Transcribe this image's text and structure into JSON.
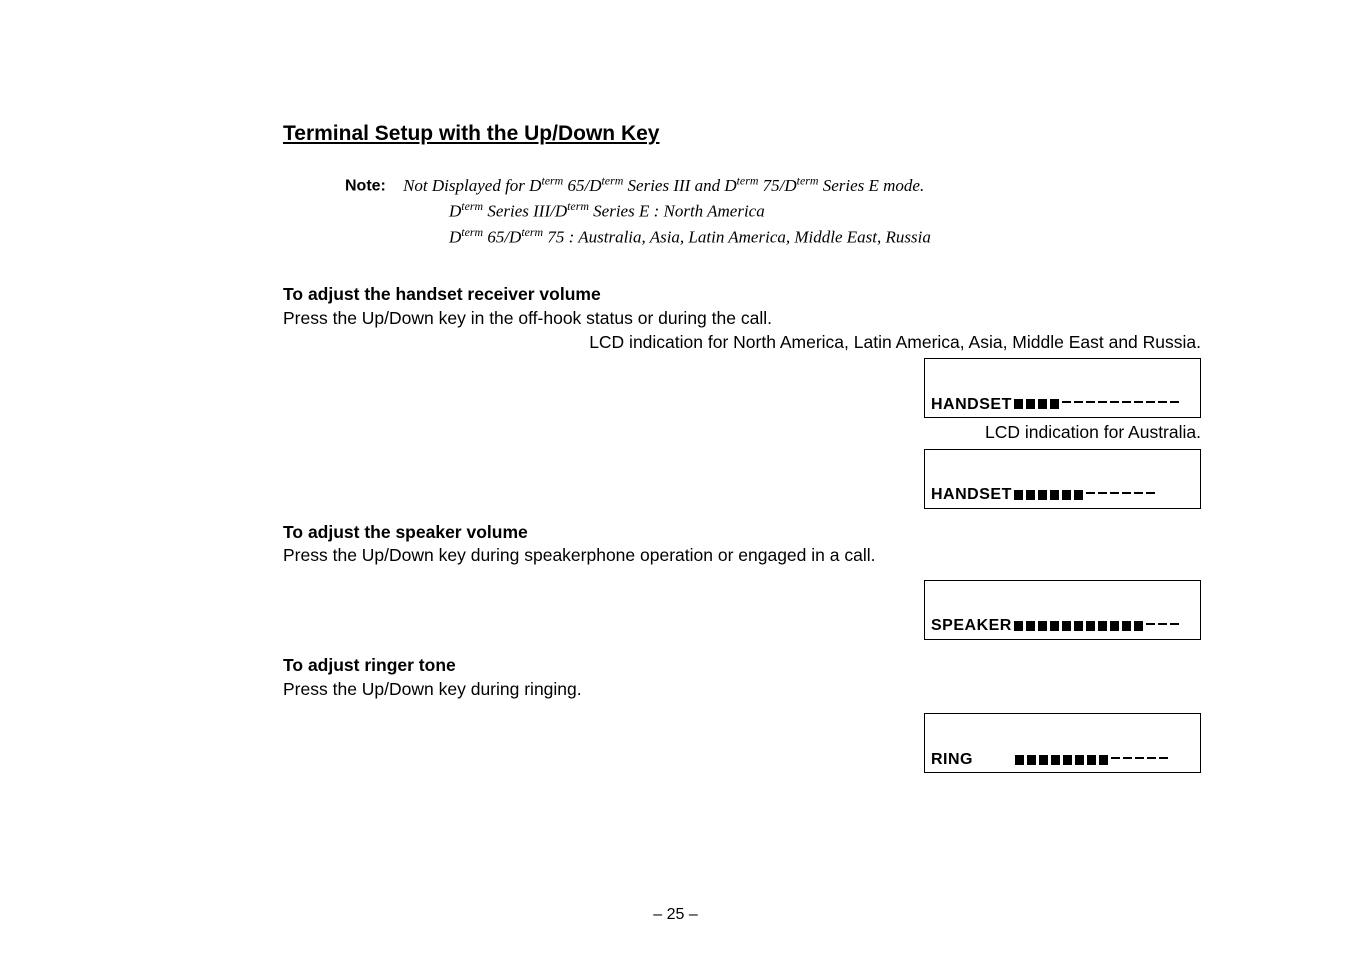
{
  "title": "Terminal Setup with the Up/Down Key",
  "note_label": "Note:",
  "note_line1_a": "Not Displayed for D",
  "note_line1_b": " 65/D",
  "note_line1_c": " Series III and D",
  "note_line1_d": " 75/D",
  "note_line1_e": " Series E mode.",
  "note_line2_a": "D",
  "note_line2_b": " Series III/D",
  "note_line2_c": " Series E : North America",
  "note_line3_a": "D",
  "note_line3_b": " 65/D",
  "note_line3_c": " 75 : Australia, Asia, Latin America, Middle East, Russia",
  "sup_term": "term",
  "sec1_head": "To adjust the handset receiver volume",
  "sec1_body": "Press the Up/Down key in the off-hook status or during the call.",
  "sec1_caption": "LCD indication for North America, Latin America, Asia, Middle East and Russia.",
  "lcd1_label": "HANDSET",
  "lcd1_filled": 4,
  "lcd1_empty": 10,
  "sec1_caption2": "LCD indication for Australia.",
  "lcd2_label": "HANDSET",
  "lcd2_filled": 6,
  "lcd2_empty": 6,
  "sec2_head": "To adjust the speaker volume",
  "sec2_body": "Press the Up/Down key during speakerphone operation or engaged in a call.",
  "lcd3_label": "SPEAKER",
  "lcd3_filled": 11,
  "lcd3_empty": 3,
  "sec3_head": "To adjust ringer tone",
  "sec3_body": "Press the Up/Down key during ringing.",
  "lcd4_label": "RING",
  "lcd4_filled": 8,
  "lcd4_empty": 5,
  "page_num": "– 25 –"
}
